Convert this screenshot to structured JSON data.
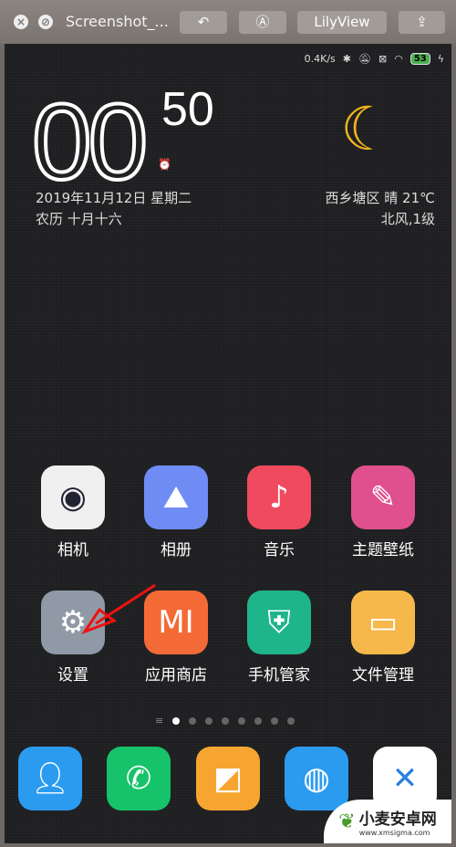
{
  "titlebar": {
    "title": "Screenshot_...",
    "lilyview": "LilyView"
  },
  "status": {
    "speed": "0.4K/s",
    "battery": "53"
  },
  "clock": {
    "hours": "00",
    "minutes": "50",
    "date": "2019年11月12日 星期二",
    "lunar": "农历 十月十六"
  },
  "weather": {
    "line1": "西乡塘区  晴  21℃",
    "line2": "北风,1级"
  },
  "apps": [
    {
      "label": "相机",
      "color": "#f0f0f0"
    },
    {
      "label": "相册",
      "color": "#6f8cf5"
    },
    {
      "label": "音乐",
      "color": "#f04a5e"
    },
    {
      "label": "主题壁纸",
      "color": "#e0508e"
    },
    {
      "label": "设置",
      "color": "#8f9aa6"
    },
    {
      "label": "应用商店",
      "color": "#f46a36"
    },
    {
      "label": "手机管家",
      "color": "#1fb58a"
    },
    {
      "label": "文件管理",
      "color": "#f6b84b"
    }
  ],
  "dock": [
    {
      "name": "contacts",
      "color": "#2b9bf0"
    },
    {
      "name": "phone",
      "color": "#17c36a"
    },
    {
      "name": "messages",
      "color": "#f6a630"
    },
    {
      "name": "browser",
      "color": "#2b9bf0"
    },
    {
      "name": "x-app",
      "color": "#ffffff"
    }
  ],
  "watermark": {
    "name": "小麦安卓网",
    "url": "www.xmsigma.com"
  }
}
